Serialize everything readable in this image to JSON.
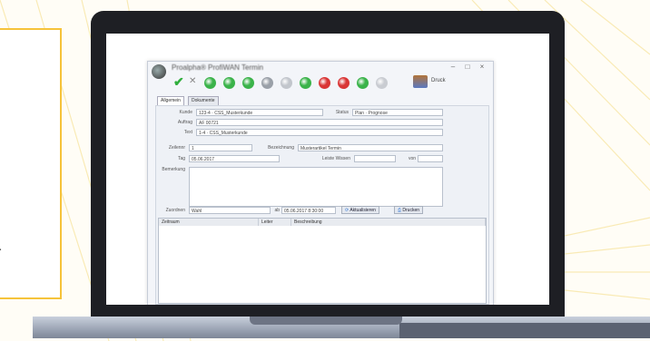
{
  "window": {
    "title": "Proalpha® ProfiWAN Termin",
    "controls": [
      "–",
      "□",
      "×"
    ]
  },
  "toolbar": {
    "confirm_icon": "check-icon",
    "cancel_icon": "x-icon",
    "print_label": "Druck",
    "buttons": [
      {
        "name": "green-circle-icon",
        "color": "#3bb34a"
      },
      {
        "name": "green-circle-icon",
        "color": "#3bb34a"
      },
      {
        "name": "green-circle-icon",
        "color": "#3bb34a"
      },
      {
        "name": "gray-circle-icon",
        "color": "#9aa0a8"
      },
      {
        "name": "gray-circle-icon",
        "color": "#c2c6cc"
      },
      {
        "name": "green-circle-icon",
        "color": "#3bb34a"
      },
      {
        "name": "red-circle-icon",
        "color": "#d93636"
      },
      {
        "name": "red-circle-icon",
        "color": "#d93636"
      },
      {
        "name": "green-circle-icon",
        "color": "#3bb34a"
      },
      {
        "name": "gray-circle-icon",
        "color": "#c9ccd2"
      }
    ]
  },
  "tabs": [
    "Allgemein",
    "Dokumente"
  ],
  "form": {
    "kunde": {
      "label": "Kunde",
      "value": "123-4 · CSS_Musterkunde"
    },
    "status": {
      "label": "Status",
      "value": "Plan · Prognose"
    },
    "auftrag": {
      "label": "Auftrag",
      "value": "AF 00721"
    },
    "text": {
      "label": "Text",
      "value": "1-4 · CSS_Musterkunde"
    },
    "zeile": {
      "label": "Zeilennr",
      "value": "1"
    },
    "bezeichnung": {
      "label": "Bezeichnung",
      "value": "Musterartikel Termin"
    },
    "tag": {
      "label": "Tag",
      "value": "05.06.2017"
    },
    "leiste": {
      "label": "Leiste Wissen",
      "value": ""
    },
    "von": {
      "label": "von",
      "value": ""
    },
    "bemerkung": {
      "label": "Bemerkung",
      "value": ""
    },
    "zuordnung": {
      "label": "Zuordnen",
      "value": "Wahl"
    },
    "ab": {
      "label": "ab",
      "value": "05.06.2017 8:30:00"
    },
    "btn_aktualisieren": "Aktualisieren",
    "btn_drucken": "Drucken"
  },
  "grid": {
    "columns": [
      "Zeitraum",
      "Leiter",
      "Beschreibung"
    ]
  },
  "side_card": {
    "text": "r"
  }
}
